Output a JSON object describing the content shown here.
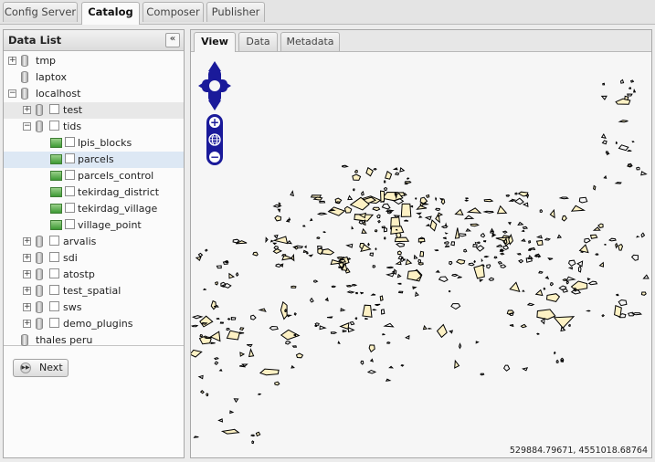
{
  "top_tabs": [
    {
      "label": "Config Server",
      "active": false
    },
    {
      "label": "Catalog",
      "active": true
    },
    {
      "label": "Composer",
      "active": false
    },
    {
      "label": "Publisher",
      "active": false
    }
  ],
  "data_list": {
    "title": "Data List",
    "collapse_icon": "double-chevron-left-icon",
    "tree": [
      {
        "label": "tmp",
        "type": "server",
        "expander": "+"
      },
      {
        "label": "laptox",
        "type": "server",
        "expander": ""
      },
      {
        "label": "localhost",
        "type": "server",
        "expander": "-"
      },
      {
        "label": "test",
        "type": "database",
        "expander": "+"
      },
      {
        "label": "tids",
        "type": "database",
        "expander": "-"
      },
      {
        "label": "lpis_blocks",
        "type": "layer",
        "expander": ""
      },
      {
        "label": "parcels",
        "type": "layer",
        "expander": "",
        "selected": true
      },
      {
        "label": "parcels_control",
        "type": "layer",
        "expander": ""
      },
      {
        "label": "tekirdag_district",
        "type": "layer",
        "expander": ""
      },
      {
        "label": "tekirdag_village",
        "type": "layer",
        "expander": ""
      },
      {
        "label": "village_point",
        "type": "layer",
        "expander": ""
      },
      {
        "label": "arvalis",
        "type": "database",
        "expander": "+"
      },
      {
        "label": "sdi",
        "type": "database",
        "expander": "+"
      },
      {
        "label": "atostp",
        "type": "database",
        "expander": "+"
      },
      {
        "label": "test_spatial",
        "type": "database",
        "expander": "+"
      },
      {
        "label": "sws",
        "type": "database",
        "expander": "+"
      },
      {
        "label": "demo_plugins",
        "type": "database",
        "expander": "+"
      },
      {
        "label": "thales peru",
        "type": "server",
        "expander": ""
      }
    ],
    "next_button": "Next"
  },
  "map_tabs": [
    {
      "label": "View",
      "active": true
    },
    {
      "label": "Data",
      "active": false
    },
    {
      "label": "Metadata",
      "active": false
    }
  ],
  "map": {
    "coordinates": "529884.79671, 4551018.68764",
    "zoom_in": "+",
    "zoom_out": "−",
    "parcel_fill": "#fdf1c4",
    "parcel_stroke": "#000000"
  },
  "colors": {
    "control_blue": "#1a1a9a",
    "selection": "#dde8f4"
  }
}
